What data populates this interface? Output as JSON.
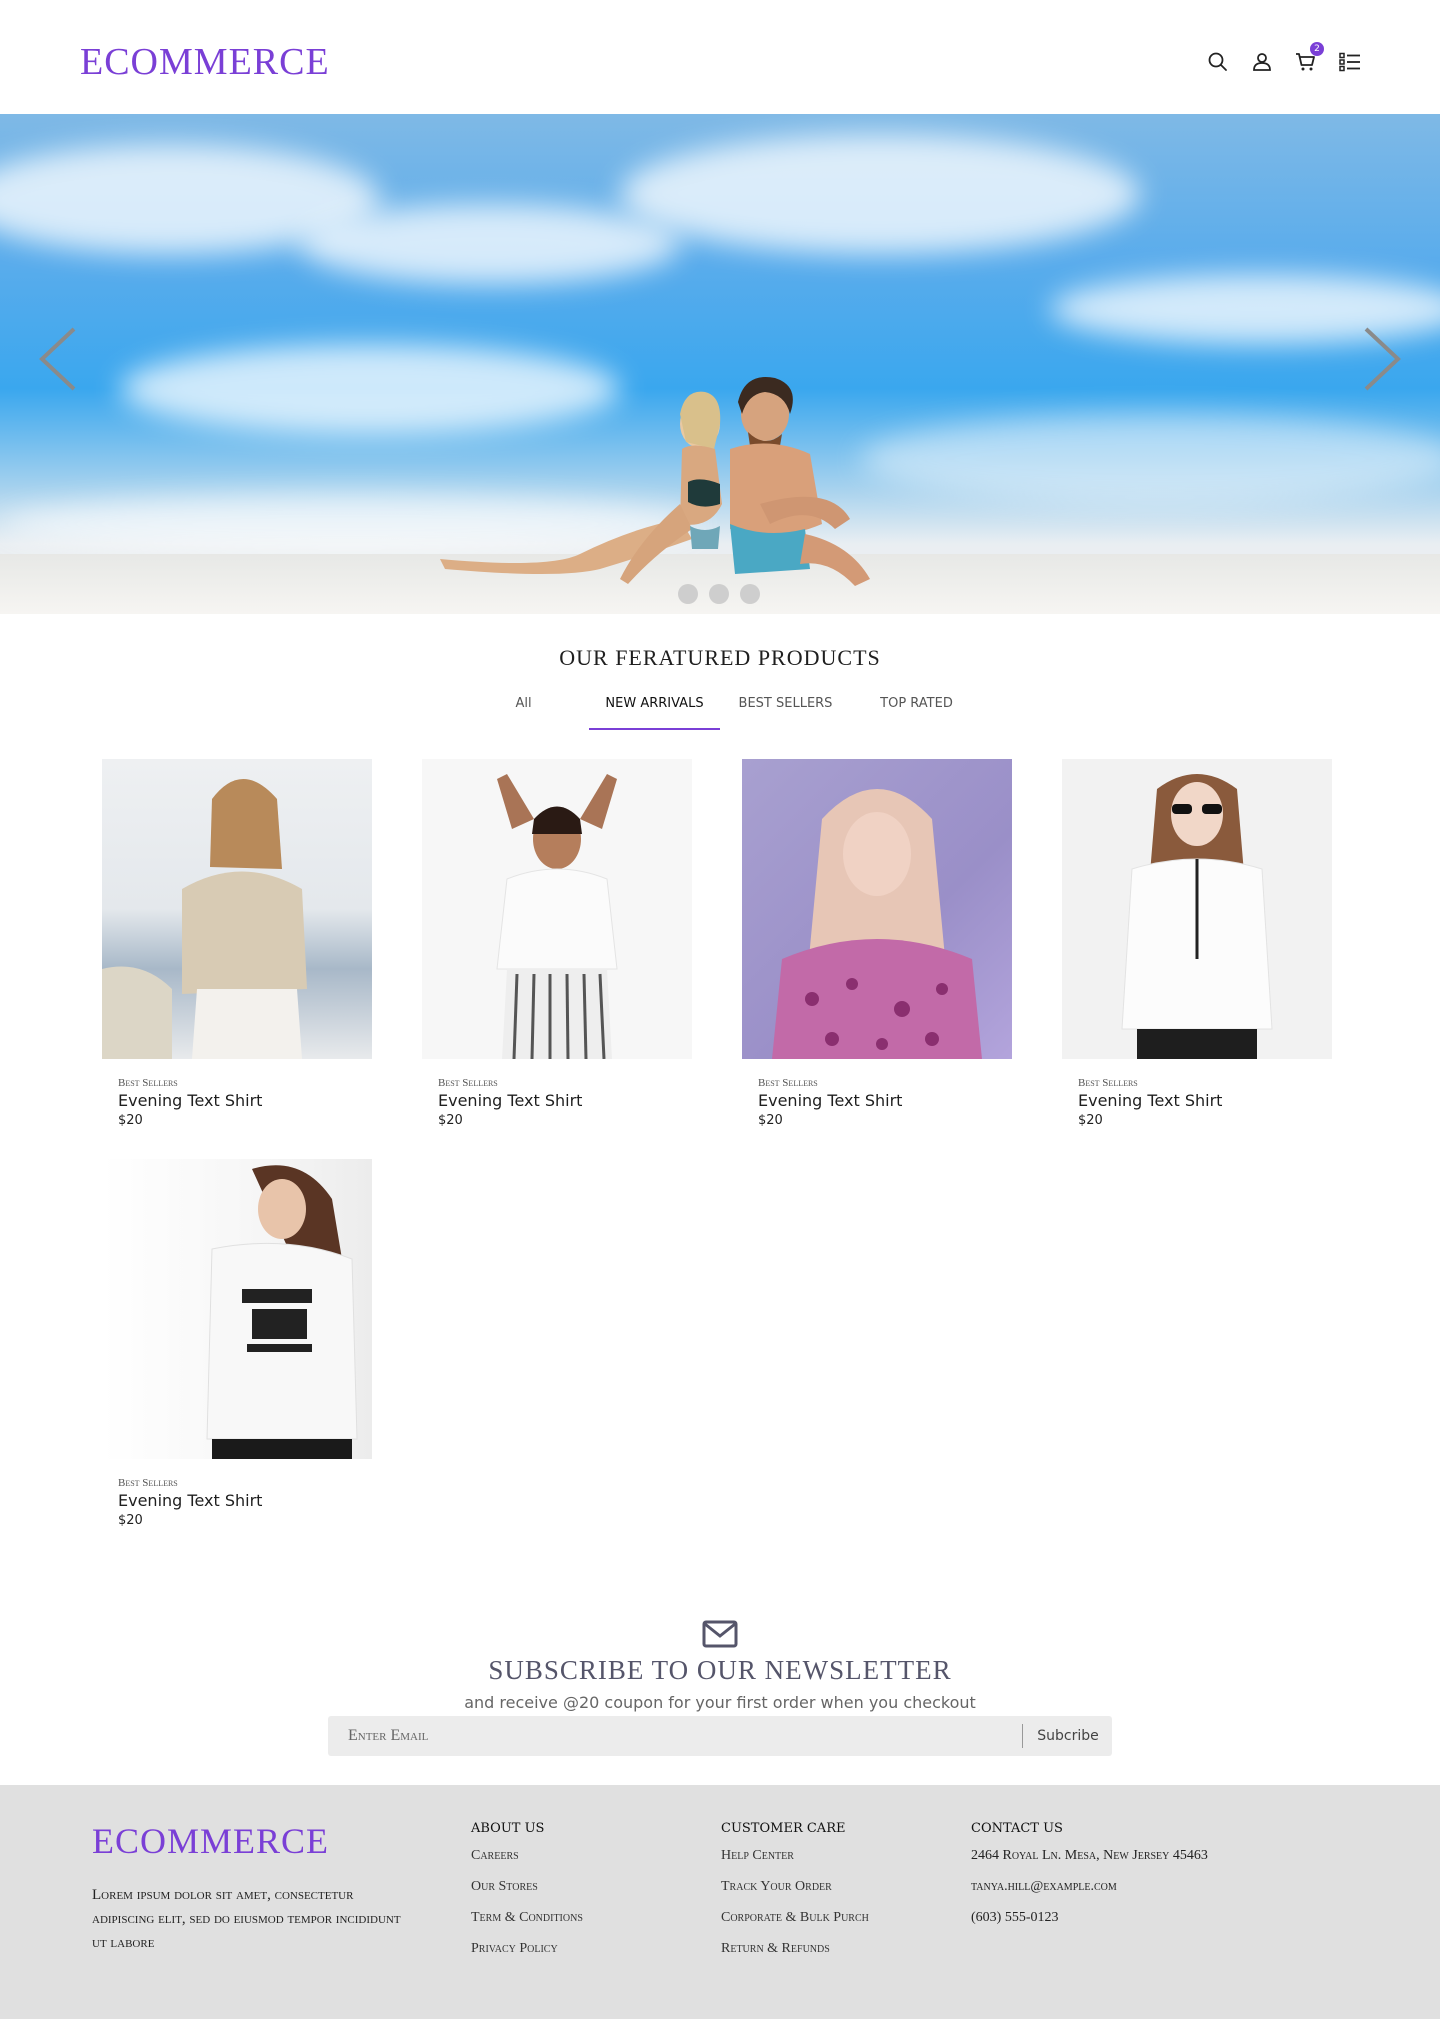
{
  "brand": {
    "logo": "ECOMMERCE",
    "accent_color": "#7a3fd6"
  },
  "header": {
    "icons": [
      "search-icon",
      "user-icon",
      "cart-icon",
      "list-menu-icon"
    ],
    "cart_count": "2"
  },
  "hero": {
    "slide_count": 3,
    "active_slide": 1
  },
  "featured": {
    "title": "OUR FERATURED PRODUCTS",
    "tabs": [
      "All",
      "NEW ARRIVALS",
      "BEST SELLERS",
      "TOP RATED"
    ],
    "active_tab": "NEW ARRIVALS"
  },
  "products": [
    {
      "category": "Best Sellers",
      "name": "Evening Text Shirt",
      "price": "$20"
    },
    {
      "category": "Best Sellers",
      "name": "Evening Text Shirt",
      "price": "$20"
    },
    {
      "category": "Best Sellers",
      "name": "Evening Text Shirt",
      "price": "$20"
    },
    {
      "category": "Best Sellers",
      "name": "Evening Text Shirt",
      "price": "$20"
    },
    {
      "category": "Best Sellers",
      "name": "Evening Text Shirt",
      "price": "$20"
    }
  ],
  "newsletter": {
    "title": "SUBSCRIBE TO OUR NEWSLETTER",
    "subtitle": "and receive @20 coupon for your first order when you checkout",
    "placeholder": "Enter Email",
    "button": "Subcribe"
  },
  "footer": {
    "logo": "ECOMMERCE",
    "description": "Lorem ipsum dolor sit amet, consectetur adipiscing elit, sed do eiusmod tempor incididunt ut labore",
    "about": {
      "heading": "ABOUT US",
      "links": [
        "Careers",
        "Our Stores",
        "Term & Conditions",
        "Privacy Policy"
      ]
    },
    "care": {
      "heading": "CUSTOMER CARE",
      "links": [
        "Help Center",
        "Track Your Order",
        "Corporate & Bulk Purch",
        "Return & Refunds"
      ]
    },
    "contact": {
      "heading": "CONTACT US",
      "lines": [
        "2464 Royal Ln. Mesa, New Jersey 45463",
        "tanya.hill@example.com",
        "(603) 555-0123"
      ]
    }
  }
}
